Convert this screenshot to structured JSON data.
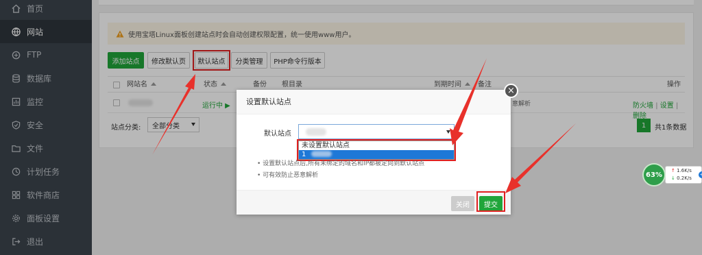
{
  "sidebar": {
    "items": [
      {
        "label": "首页",
        "icon": "home-icon"
      },
      {
        "label": "网站",
        "icon": "globe-icon"
      },
      {
        "label": "FTP",
        "icon": "ftp-icon"
      },
      {
        "label": "数据库",
        "icon": "database-icon"
      },
      {
        "label": "监控",
        "icon": "monitor-icon"
      },
      {
        "label": "安全",
        "icon": "shield-icon"
      },
      {
        "label": "文件",
        "icon": "folder-icon"
      },
      {
        "label": "计划任务",
        "icon": "clock-icon"
      },
      {
        "label": "软件商店",
        "icon": "grid-icon"
      },
      {
        "label": "面板设置",
        "icon": "gear-icon"
      },
      {
        "label": "退出",
        "icon": "logout-icon"
      }
    ]
  },
  "notice": {
    "text": "使用宝塔Linux面板创建站点时会自动创建权限配置，统一使用www用户。"
  },
  "toolbar": {
    "add_site": "添加站点",
    "edit_default_page": "修改默认页",
    "default_site": "默认站点",
    "category_manage": "分类管理",
    "php_cli_version": "PHP命令行版本"
  },
  "table": {
    "headers": {
      "site_name": "网站名",
      "status": "状态",
      "backup": "备份",
      "root": "根目录",
      "expire": "到期时间",
      "remark": "备注",
      "action": "操作"
    },
    "row": {
      "status": "运行中 ▶",
      "remark_fragment": "意解析",
      "actions": {
        "firewall": "防火墙",
        "settings": "设置",
        "delete": "删除",
        "sep": "|"
      }
    }
  },
  "filter": {
    "label": "站点分类:",
    "value": "全部分类"
  },
  "pagination": {
    "current_page": "1",
    "summary": "共1条数据"
  },
  "modal": {
    "title": "设置默认站点",
    "close_symbol": "×",
    "field_label": "默认站点",
    "options": [
      "未设置默认站点",
      "1"
    ],
    "tips": [
      "设置默认站点后,所有未绑定的域名和IP都被定向到默认站点",
      "可有效防止恶意解析"
    ],
    "buttons": {
      "close": "关闭",
      "submit": "提交"
    }
  },
  "speed_widget": {
    "percent": "63%",
    "up": "1.6K/s",
    "down": "0.2K/s",
    "up_arrow": "↑",
    "down_arrow": "↓"
  },
  "colors": {
    "accent": "#20a53a",
    "highlight": "#e02020",
    "sidebar": "#3c444d",
    "selection": "#1e78d7"
  }
}
